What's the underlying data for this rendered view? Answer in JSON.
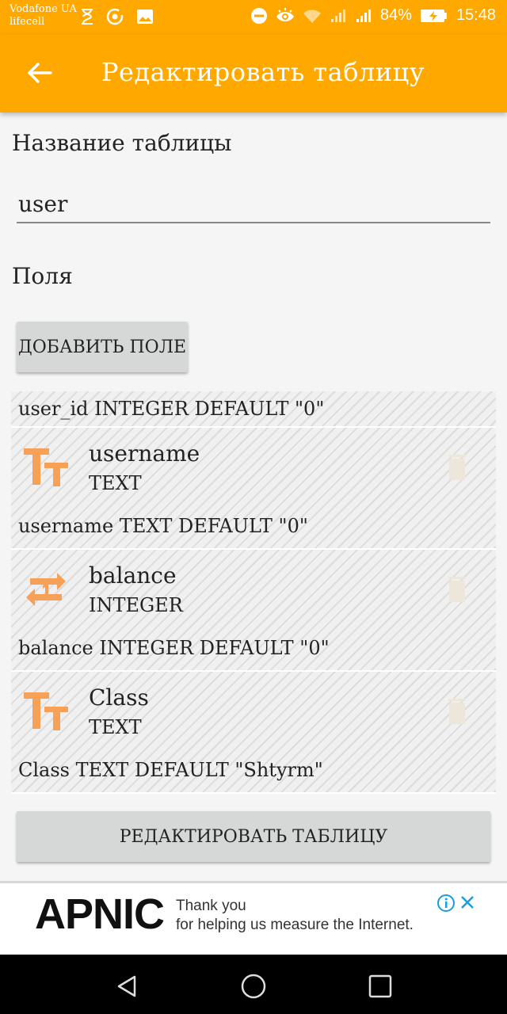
{
  "status_bar": {
    "carrier_1": "Vodafone UA",
    "carrier_2": "lifecell",
    "battery": "84%",
    "time": "15:48"
  },
  "app_bar": {
    "title": "Редактировать таблицу"
  },
  "form": {
    "name_label": "Название таблицы",
    "table_name": "user",
    "fields_label": "Поля",
    "add_field_button": "ДОБАВИТЬ ПОЛЕ",
    "edit_button": "РЕДАКТИРОВАТЬ ТАБЛИЦУ"
  },
  "fields": {
    "first_sql": "user_id INTEGER DEFAULT \"0\"",
    "items": [
      {
        "name": "username",
        "type": "TEXT",
        "sql": "username TEXT DEFAULT \"0\"",
        "icon": "text-type-icon"
      },
      {
        "name": "balance",
        "type": "INTEGER",
        "sql": "balance INTEGER DEFAULT \"0\"",
        "icon": "integer-type-icon"
      },
      {
        "name": "Class",
        "type": "TEXT",
        "sql": "Class TEXT DEFAULT \"Shtyrm\"",
        "icon": "text-type-icon"
      }
    ]
  },
  "ad": {
    "logo": "APNIC",
    "line1": "Thank you",
    "line2": "for helping us measure the Internet."
  },
  "colors": {
    "accent": "#FFA800",
    "icon_orange": "#F7A158"
  }
}
